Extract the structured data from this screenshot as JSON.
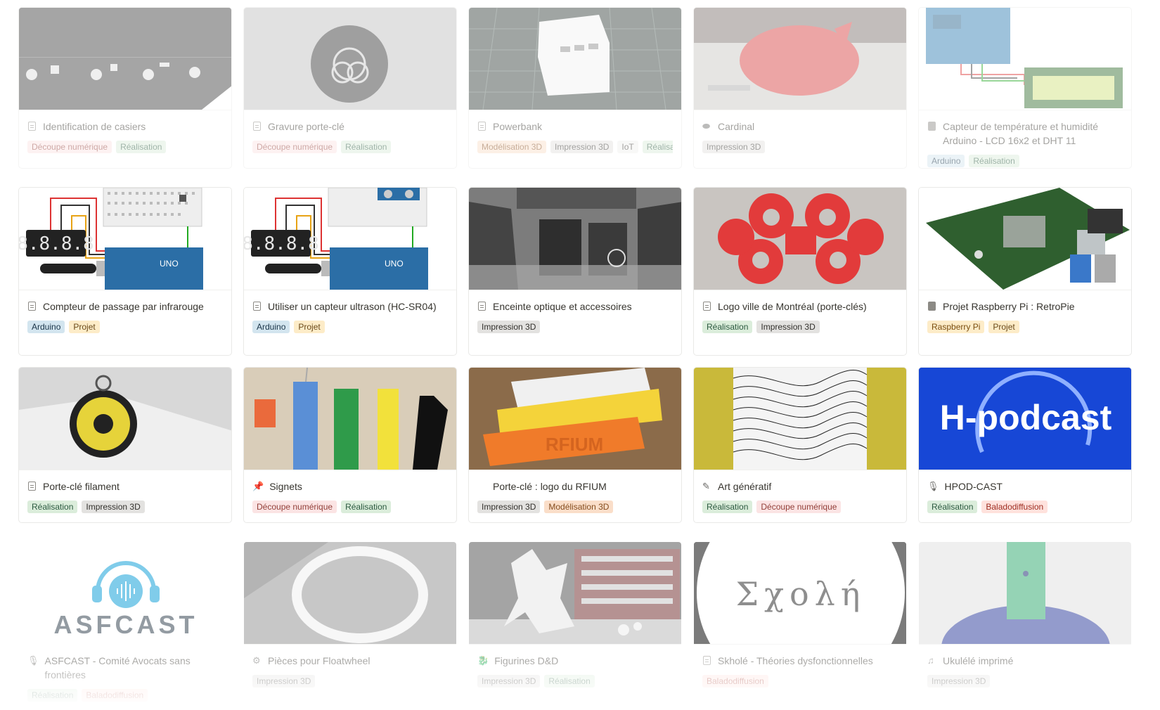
{
  "gallery": {
    "cards": [
      {
        "title": "Identification de casiers",
        "icon": "page-icon",
        "tags": [
          "Découpe numérique",
          "Réalisation"
        ]
      },
      {
        "title": "Gravure porte-clé",
        "icon": "page-icon",
        "tags": [
          "Découpe numérique",
          "Réalisation"
        ]
      },
      {
        "title": "Powerbank",
        "icon": "page-icon",
        "tags": [
          "Modélisation 3D",
          "Impression 3D",
          "IoT",
          "Réalisat"
        ]
      },
      {
        "title": "Cardinal",
        "icon": "bird-icon",
        "tags": [
          "Impression 3D"
        ]
      },
      {
        "title": "Capteur de température et humidité Arduino - LCD 16x2 et DHT 11",
        "icon": "filled-page-icon",
        "tags": [
          "Arduino",
          "Réalisation"
        ]
      },
      {
        "title": "Compteur de passage par infrarouge",
        "icon": "page-icon",
        "tags": [
          "Arduino",
          "Projet"
        ]
      },
      {
        "title": "Utiliser un capteur ultrason (HC-SR04)",
        "icon": "page-icon",
        "tags": [
          "Arduino",
          "Projet"
        ]
      },
      {
        "title": "Enceinte optique et accessoires",
        "icon": "page-icon",
        "tags": [
          "Impression 3D"
        ]
      },
      {
        "title": "Logo ville de Montréal (porte-clés)",
        "icon": "page-icon",
        "tags": [
          "Réalisation",
          "Impression 3D"
        ]
      },
      {
        "title": "Projet Raspberry Pi : RetroPie",
        "icon": "filled-page-icon",
        "tags": [
          "Raspberry Pi",
          "Projet"
        ]
      },
      {
        "title": "Porte-clé filament",
        "icon": "page-icon",
        "tags": [
          "Réalisation",
          "Impression 3D"
        ]
      },
      {
        "title": "Signets",
        "icon": "pushpin-icon",
        "tags": [
          "Découpe numérique",
          "Réalisation"
        ]
      },
      {
        "title": "Porte-clé : logo du RFIUM",
        "icon": "none",
        "tags": [
          "Impression 3D",
          "Modélisation 3D"
        ]
      },
      {
        "title": "Art génératif",
        "icon": "pencil-icon",
        "tags": [
          "Réalisation",
          "Découpe numérique"
        ]
      },
      {
        "title": "HPOD-CAST",
        "icon": "microphone-icon",
        "tags": [
          "Réalisation",
          "Baladodiffusion"
        ]
      },
      {
        "title": "ASFCAST - Comité Avocats sans frontières",
        "icon": "microphone-icon",
        "tags": [
          "Réalisation",
          "Baladodiffusion"
        ]
      },
      {
        "title": "Pièces pour Floatwheel",
        "icon": "gear-icon",
        "tags": [
          "Impression 3D"
        ]
      },
      {
        "title": "Figurines D&D",
        "icon": "dragon-icon",
        "tags": [
          "Impression 3D",
          "Réalisation"
        ]
      },
      {
        "title": "Skholé - Théories dysfonctionnelles",
        "icon": "page-icon",
        "tags": [
          "Baladodiffusion"
        ]
      },
      {
        "title": "Ukulélé imprimé",
        "icon": "music-icon",
        "tags": [
          "Impression 3D"
        ]
      }
    ]
  },
  "thumb_text": {
    "hpodcast": "H-podcast",
    "asfcast": "ASFCAST",
    "skhole": "Σχολή",
    "rfium": "RFIUM",
    "segment": "8.8.8.8",
    "uno": "UNO"
  }
}
